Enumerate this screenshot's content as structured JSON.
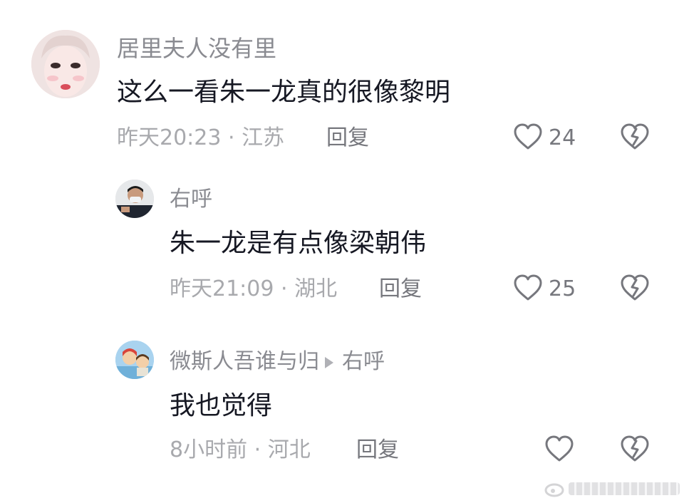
{
  "comments": [
    {
      "author": "居里夫人没有里",
      "text": "这么一看朱一龙真的很像黎明",
      "time_location": "昨天20:23 · 江苏",
      "reply_label": "回复",
      "like_count": "24",
      "avatar": "woman-portrait-avatar"
    },
    {
      "author": "右呼",
      "text": "朱一龙是有点像梁朝伟",
      "time_location": "昨天21:09 · 湖北",
      "reply_label": "回复",
      "like_count": "25",
      "avatar": "masked-man-avatar"
    },
    {
      "author": "微斯人吾谁与归",
      "reply_to": "右呼",
      "text": "我也觉得",
      "time_location": "8小时前 · 河北",
      "reply_label": "回复",
      "like_count": "",
      "avatar": "anime-girl-avatar"
    }
  ],
  "watermark": "微博",
  "colors": {
    "primary_text": "#161823",
    "secondary_text": "#8a8b91",
    "meta_text": "#a8a9ad",
    "icon_stroke": "#76777d"
  }
}
